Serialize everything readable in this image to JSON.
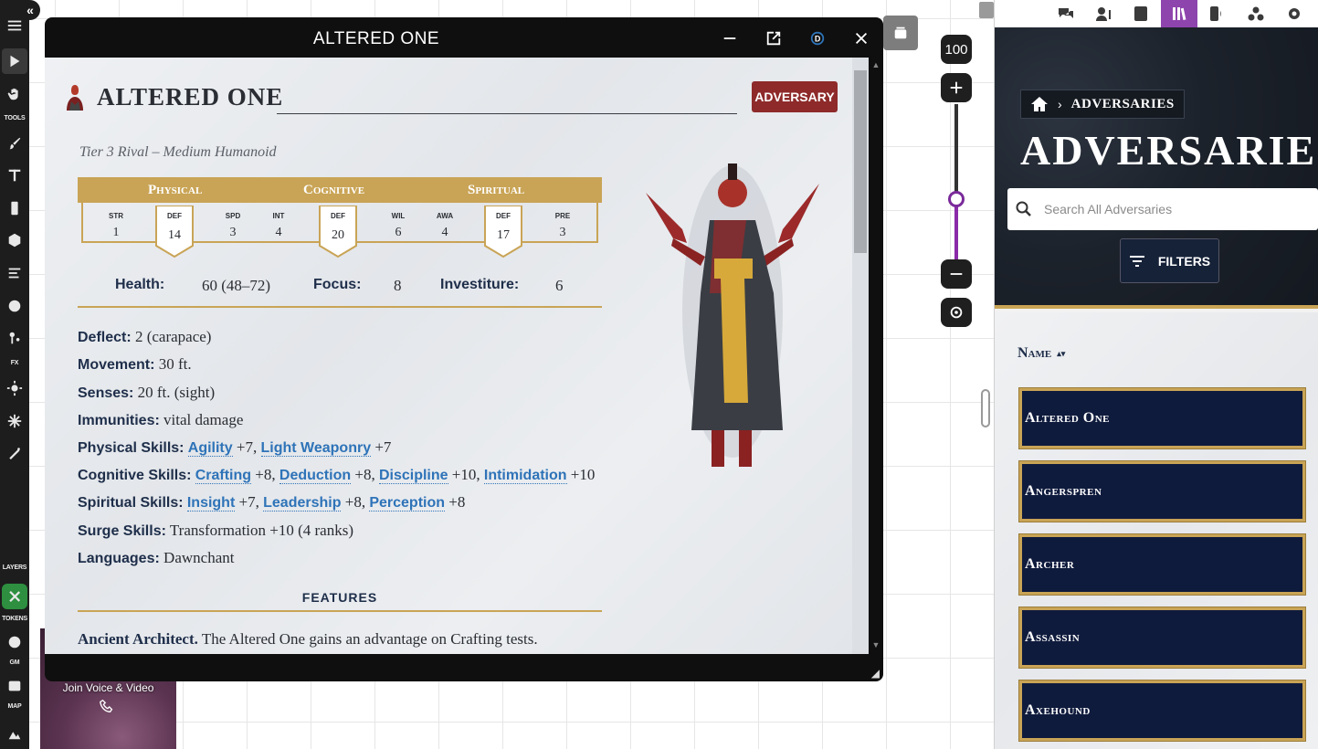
{
  "left_toolbar": {
    "labels": [
      "TOOLS",
      "FX",
      "LAYERS",
      "TOKENS",
      "GM",
      "MAP"
    ]
  },
  "video": {
    "join_label": "Join Voice & Video"
  },
  "window": {
    "title": "ALTERED ONE"
  },
  "adversary": {
    "name": "ALTERED ONE",
    "badge": "ADVERSARY",
    "tier_line": "Tier 3 Rival – Medium Humanoid",
    "categories": [
      "Physical",
      "Cognitive",
      "Spiritual"
    ],
    "stats": {
      "str": {
        "label": "STR",
        "value": "1"
      },
      "def_phys": {
        "label": "DEF",
        "value": "14"
      },
      "spd": {
        "label": "SPD",
        "value": "3"
      },
      "int": {
        "label": "INT",
        "value": "4"
      },
      "def_cog": {
        "label": "DEF",
        "value": "20"
      },
      "wil": {
        "label": "WIL",
        "value": "6"
      },
      "awa": {
        "label": "AWA",
        "value": "4"
      },
      "def_spir": {
        "label": "DEF",
        "value": "17"
      },
      "pre": {
        "label": "PRE",
        "value": "3"
      }
    },
    "resources": {
      "health_label": "Health:",
      "health": "60 (48–72)",
      "focus_label": "Focus:",
      "focus": "8",
      "investiture_label": "Investiture:",
      "investiture": "6"
    },
    "traits": {
      "deflect_label": "Deflect:",
      "deflect": " 2 (carapace)",
      "movement_label": "Movement:",
      "movement": " 30 ft.",
      "senses_label": "Senses:",
      "senses": " 20 ft. (sight)",
      "immunities_label": "Immunities:",
      "immunities": " vital damage",
      "physical_label": "Physical Skills:",
      "physical_skills": [
        {
          "name": "Agility",
          "bonus": " +7, "
        },
        {
          "name": "Light Weaponry",
          "bonus": " +7"
        }
      ],
      "cognitive_label": "Cognitive Skills:",
      "cognitive_skills": [
        {
          "name": "Crafting",
          "bonus": " +8, "
        },
        {
          "name": "Deduction",
          "bonus": " +8, "
        },
        {
          "name": "Discipline",
          "bonus": " +10, "
        },
        {
          "name": "Intimidation",
          "bonus": " +10"
        }
      ],
      "spiritual_label": "Spiritual Skills:",
      "spiritual_skills": [
        {
          "name": "Insight",
          "bonus": " +7, "
        },
        {
          "name": "Leadership",
          "bonus": " +8, "
        },
        {
          "name": "Perception",
          "bonus": " +8"
        }
      ],
      "surge_label": "Surge Skills:",
      "surge": " Transformation +10 (4 ranks)",
      "languages_label": "Languages:",
      "languages": " Dawnchant"
    },
    "features_heading": "FEATURES",
    "feature_1_name": "Ancient Architect.",
    "feature_1_text": " The Altered One gains an advantage on Crafting tests."
  },
  "zoom": {
    "level": "100",
    "slider_fraction": 0.39
  },
  "sidebar": {
    "breadcrumb": "ADVERSARIES",
    "title": "ADVERSARIES",
    "search_placeholder": "Search All Adversaries",
    "filters_label": "FILTERS",
    "sort_label": "Name",
    "items": [
      "Altered One",
      "Angerspren",
      "Archer",
      "Assassin",
      "Axehound"
    ]
  },
  "colors": {
    "accent_gold": "#c9a456",
    "badge_red": "#8e2a2a",
    "navy": "#0f1b3d",
    "link_blue": "#2e73b8",
    "active_tab": "#8e44ad"
  }
}
